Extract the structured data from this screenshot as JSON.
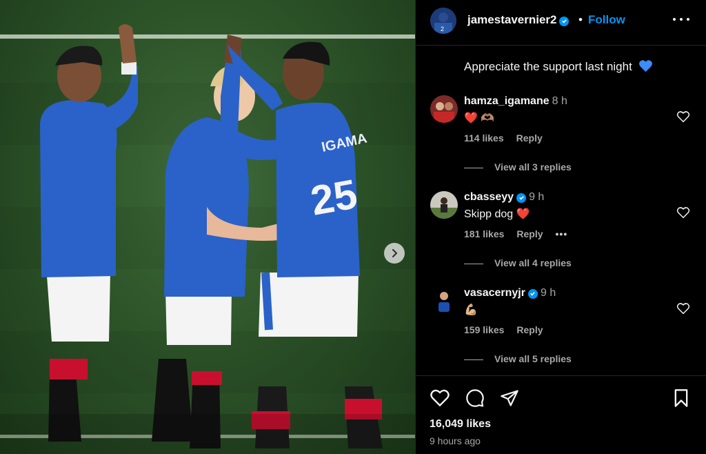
{
  "post": {
    "author": "jamestavernier2",
    "separator": "•",
    "follow_label": "Follow",
    "caption": "Appreciate the support last night",
    "likes": "16,049 likes",
    "time_ago": "9 hours ago"
  },
  "photo": {
    "shirt_name": "IGAMA",
    "shirt_number": "25"
  },
  "comments": [
    {
      "user": "hamza_igamane",
      "verified": false,
      "time": "8 h",
      "text": "❤️ 🫶🏽",
      "likes": "114 likes",
      "reply": "Reply",
      "view_replies": "View all 3 replies"
    },
    {
      "user": "cbasseyy",
      "verified": true,
      "time": "9 h",
      "text": "Skipp dog ❤️",
      "likes": "181 likes",
      "reply": "Reply",
      "view_replies": "View all 4 replies"
    },
    {
      "user": "vasacernyjr",
      "verified": true,
      "time": "9 h",
      "text": "💪🏼",
      "likes": "159 likes",
      "reply": "Reply",
      "view_replies": "View all 5 replies"
    }
  ],
  "colors": {
    "accent": "#0095f6",
    "heart_blue": "#3d8bfd",
    "muted": "#a8a8a8"
  }
}
